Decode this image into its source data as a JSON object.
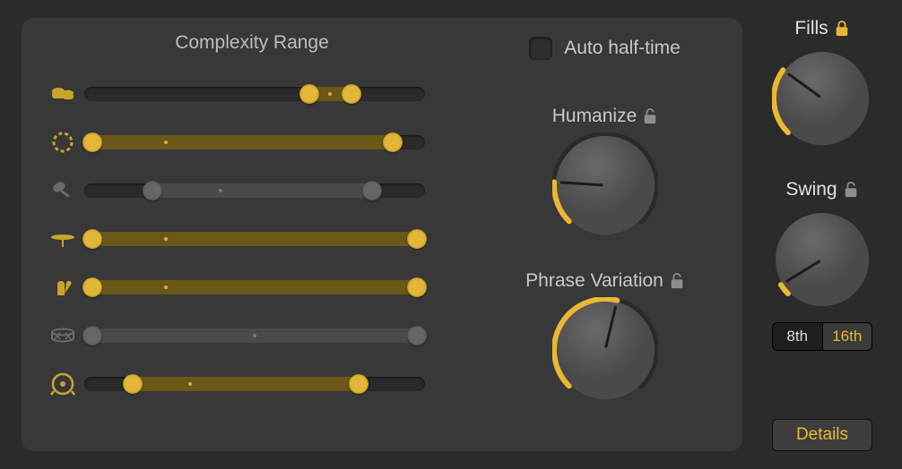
{
  "complexity": {
    "title": "Complexity Range",
    "tracks": [
      {
        "icon": "bongos-icon",
        "active": true,
        "lo": 0.64,
        "hi": 0.8,
        "center": 0.72
      },
      {
        "icon": "tambourine-icon",
        "active": true,
        "lo": 0.0,
        "hi": 0.92,
        "center": 0.24
      },
      {
        "icon": "shaker-icon",
        "active": false,
        "lo": 0.18,
        "hi": 0.86,
        "center": 0.4
      },
      {
        "icon": "cymbal-icon",
        "active": true,
        "lo": 0.0,
        "hi": 1.0,
        "center": 0.24
      },
      {
        "icon": "claps-icon",
        "active": true,
        "lo": 0.0,
        "hi": 1.0,
        "center": 0.24
      },
      {
        "icon": "snare-icon",
        "active": false,
        "lo": 0.0,
        "hi": 1.0,
        "center": 0.5
      },
      {
        "icon": "kick-icon",
        "active": true,
        "lo": 0.12,
        "hi": 0.82,
        "center": 0.31
      }
    ]
  },
  "auto_half_time": {
    "label": "Auto half-time",
    "checked": false
  },
  "humanize": {
    "label": "Humanize",
    "locked": false,
    "value": 0.18
  },
  "phrase_variation": {
    "label": "Phrase Variation",
    "locked": false,
    "value": 0.55
  },
  "fills": {
    "label": "Fills",
    "locked": true,
    "value": 0.3
  },
  "swing": {
    "label": "Swing",
    "locked": false,
    "value": 0.05,
    "options": [
      "8th",
      "16th"
    ],
    "selected": "16th"
  },
  "details_label": "Details",
  "colors": {
    "accent": "#e9b833",
    "accent_dark": "#6b5718",
    "bg": "#2b2b2b",
    "panel": "#383838"
  }
}
